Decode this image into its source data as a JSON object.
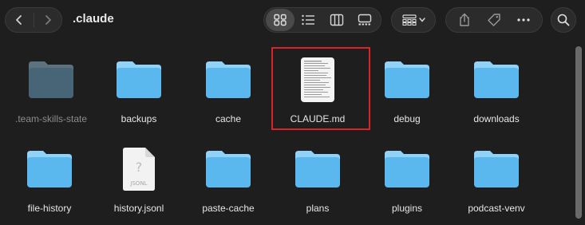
{
  "window": {
    "title": ".claude"
  },
  "toolbar": {
    "view_modes": [
      "icon-view",
      "list-view",
      "column-view",
      "gallery-view"
    ],
    "active_view": "icon-view"
  },
  "files": [
    {
      "name": ".team-skills-state",
      "type": "folder",
      "dim": true
    },
    {
      "name": "backups",
      "type": "folder"
    },
    {
      "name": "cache",
      "type": "folder"
    },
    {
      "name": "CLAUDE.md",
      "type": "document",
      "selected": true
    },
    {
      "name": "debug",
      "type": "folder"
    },
    {
      "name": "downloads",
      "type": "folder"
    },
    {
      "name": "file-history",
      "type": "folder"
    },
    {
      "name": "history.jsonl",
      "type": "jsonl",
      "badge": "JSONL"
    },
    {
      "name": "paste-cache",
      "type": "folder"
    },
    {
      "name": "plans",
      "type": "folder"
    },
    {
      "name": "plugins",
      "type": "folder"
    },
    {
      "name": "podcast-venv",
      "type": "folder"
    }
  ],
  "colors": {
    "folder_top": "#8fd3f9",
    "folder_body": "#5ab8ef",
    "selection": "#d8232a",
    "background": "#1e1e1e"
  }
}
